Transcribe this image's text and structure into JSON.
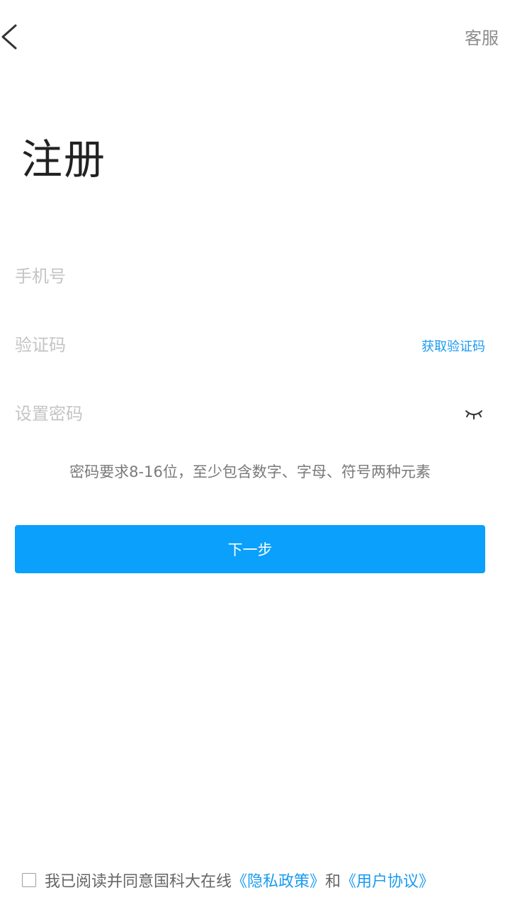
{
  "header": {
    "customer_service": "客服"
  },
  "page_title": "注册",
  "form": {
    "phone": {
      "placeholder": "手机号",
      "value": ""
    },
    "code": {
      "placeholder": "验证码",
      "value": "",
      "get_code_label": "获取验证码"
    },
    "password": {
      "placeholder": "设置密码",
      "value": ""
    },
    "password_hint": "密码要求8-16位，至少包含数字、字母、符号两种元素",
    "next_label": "下一步"
  },
  "agreement": {
    "checked": false,
    "prefix": "我已阅读并同意国科大在线",
    "privacy_link": "《隐私政策》",
    "and": "和",
    "user_link": "《用户协议》"
  },
  "colors": {
    "accent": "#0aa0fb",
    "link": "#1a9bf0",
    "placeholder": "#c4c4c4"
  },
  "icons": {
    "back": "chevron-left-icon",
    "password_visibility": "eye-closed-icon"
  }
}
